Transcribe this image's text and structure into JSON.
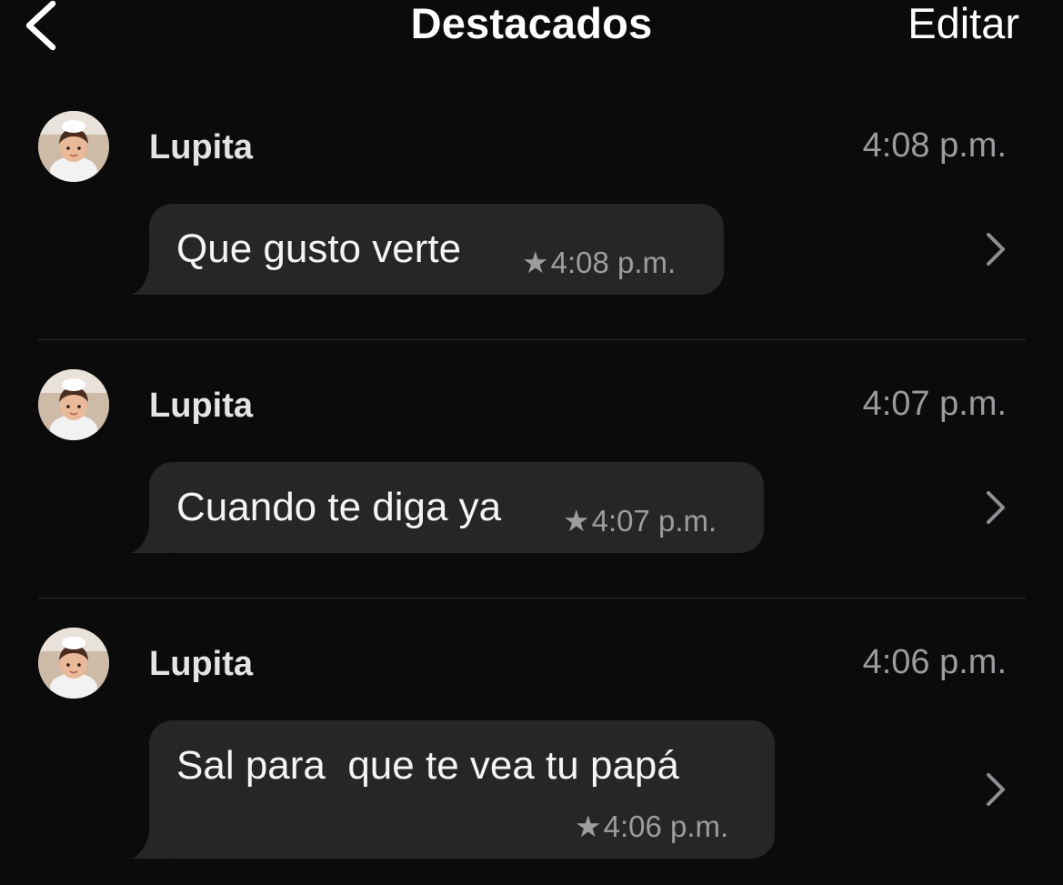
{
  "header": {
    "back_icon": "chevron-left-icon",
    "title": "Destacados",
    "edit_label": "Editar"
  },
  "messages": [
    {
      "sender": "Lupita",
      "time": "4:08 p.m.",
      "text": "Que gusto verte",
      "meta_time": "4:08 p.m.",
      "starred": true
    },
    {
      "sender": "Lupita",
      "time": "4:07 p.m.",
      "text": "Cuando te diga ya",
      "meta_time": "4:07 p.m.",
      "starred": true
    },
    {
      "sender": "Lupita",
      "time": "4:06 p.m.",
      "text": "Sal para  que te vea tu papá",
      "meta_time": "4:06 p.m.",
      "starred": true
    }
  ],
  "colors": {
    "background": "#0b0b0b",
    "bubble": "#262626",
    "secondary_text": "#9a9a9f"
  }
}
